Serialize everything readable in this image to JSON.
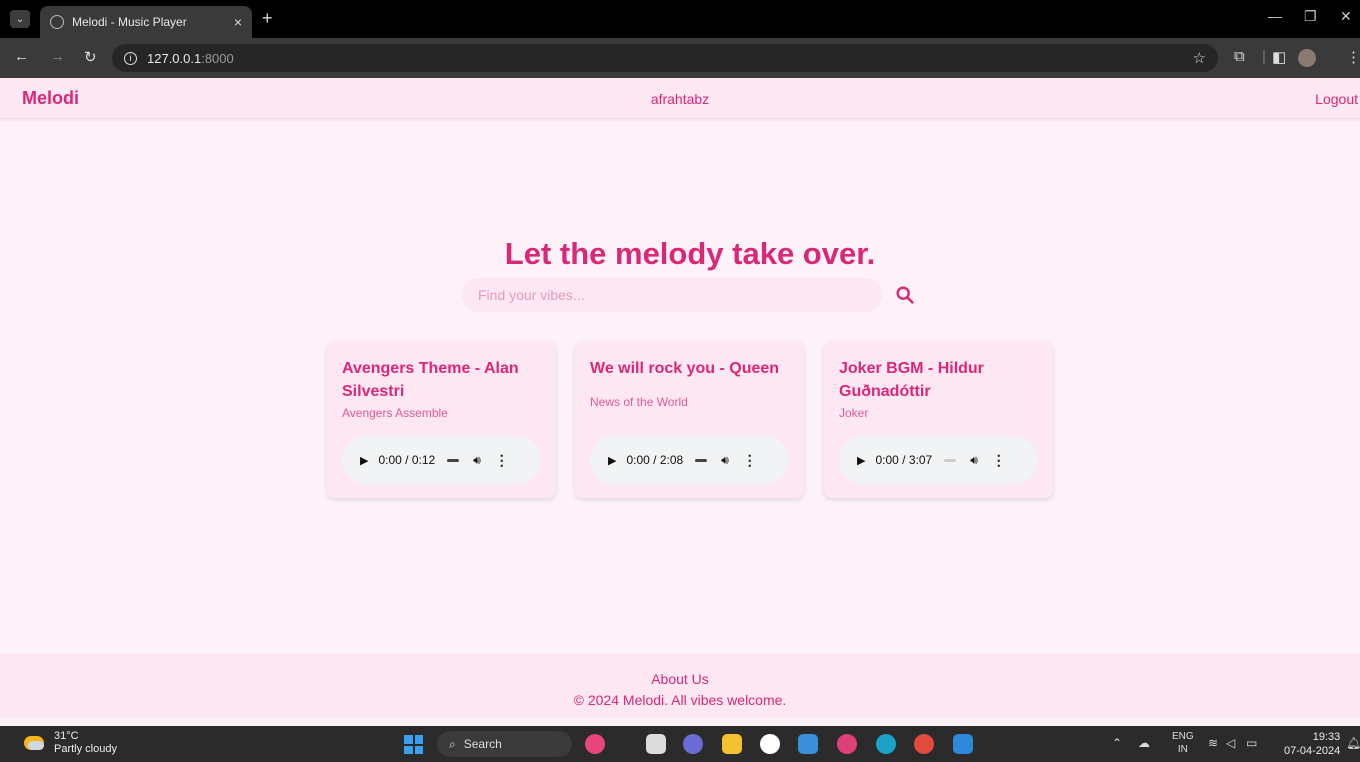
{
  "browser": {
    "tab_title": "Melodi - Music Player",
    "url_host": "127.0.0.1",
    "url_port": ":8000"
  },
  "navbar": {
    "brand": "Melodi",
    "username": "afrahtabz",
    "logout": "Logout"
  },
  "hero": {
    "title": "Let the melody take over.",
    "search_placeholder": "Find your vibes..."
  },
  "songs": [
    {
      "title": "Avengers Theme - Alan Silvestri",
      "album": "Avengers Assemble",
      "time": "0:00 / 0:12"
    },
    {
      "title": "We will rock you - Queen",
      "album": "News of the World",
      "time": "0:00 / 2:08"
    },
    {
      "title": "Joker BGM - Hildur Guðnadóttir",
      "album": "Joker",
      "time": "0:00 / 3:07"
    }
  ],
  "footer": {
    "about": "About Us",
    "copyright": "© 2024 Melodi. All vibes welcome."
  },
  "taskbar": {
    "temperature": "31°C",
    "weather": "Partly cloudy",
    "search": "Search",
    "lang_top": "ENG",
    "lang_bottom": "IN",
    "time": "19:33",
    "date": "07-04-2024"
  },
  "colors": {
    "accent": "#db2777",
    "surface": "#fce7f3",
    "background": "#fdf2f8"
  }
}
